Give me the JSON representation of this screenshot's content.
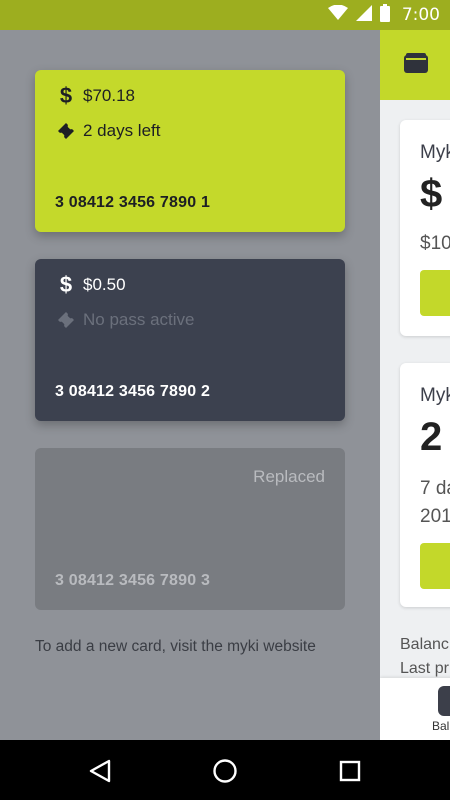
{
  "status_bar": {
    "time": "7:00",
    "icons": [
      "wifi-icon",
      "signal-icon",
      "battery-icon"
    ]
  },
  "drawer": {
    "cards": [
      {
        "balance": "$70.18",
        "pass_text": "2 days left",
        "card_number": "3 08412 3456 7890 1",
        "status": "",
        "color": "#c4d92b"
      },
      {
        "balance": "$0.50",
        "pass_text": "No pass active",
        "card_number": "3 08412 3456 7890 2",
        "status": "",
        "color": "#3c414f"
      },
      {
        "balance": "",
        "pass_text": "",
        "card_number": "3 08412 3456 7890 3",
        "status": "Replaced",
        "color": "#797c81"
      }
    ],
    "hint": "To add a new card, visit the myki website"
  },
  "main": {
    "accent_color": "#c3d82a",
    "balance_card": {
      "label": "Myk",
      "big_value": "$",
      "sub_text": "$10"
    },
    "pass_card": {
      "label": "Myk",
      "big_value": "2",
      "sub_line_1": "7 da",
      "sub_line_2": "201"
    },
    "footer_line_1": "Balanc",
    "footer_line_2": "Last pr",
    "bottom_nav_label": "Bal"
  },
  "nav_bar": {
    "icons": [
      "back-icon",
      "home-icon",
      "recents-icon"
    ]
  }
}
